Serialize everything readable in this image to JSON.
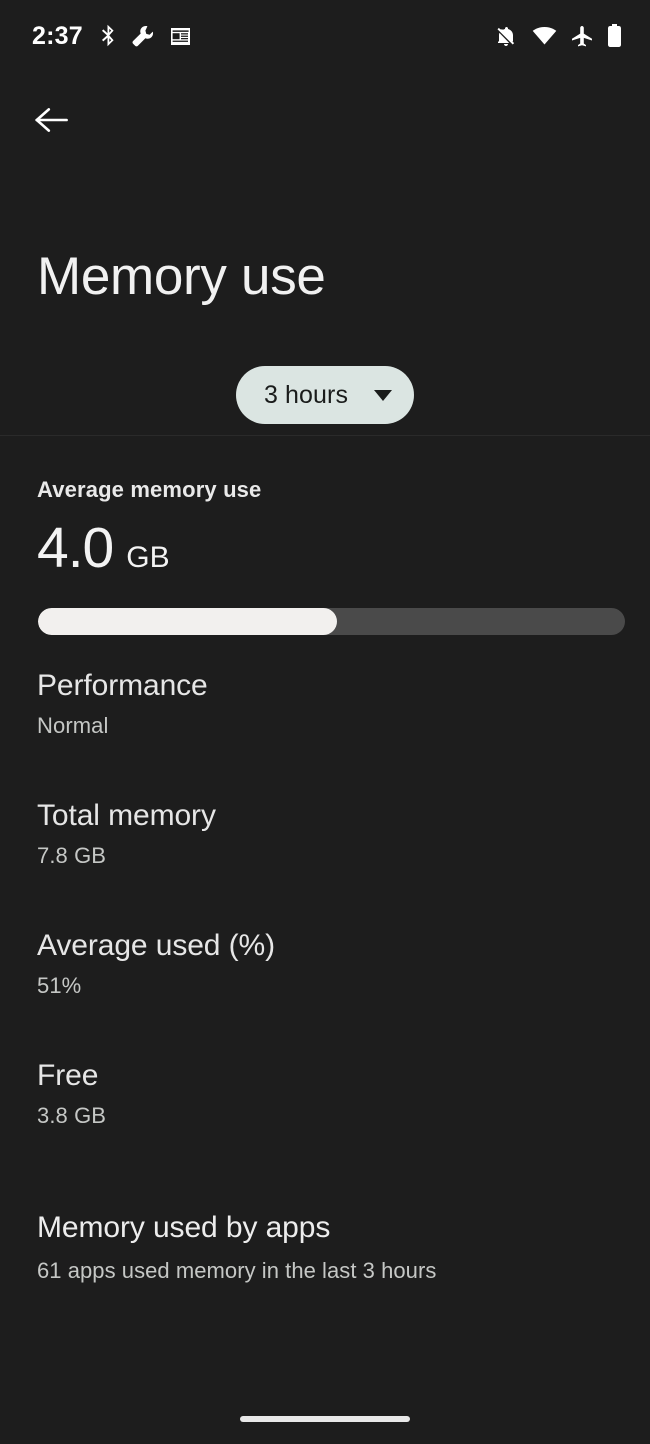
{
  "status_bar": {
    "time": "2:37",
    "left_icons": [
      "bluetooth-icon",
      "wrench-icon",
      "news-icon"
    ],
    "right_icons": [
      "notifications-off-icon",
      "wifi-icon",
      "airplane-mode-icon",
      "battery-icon"
    ]
  },
  "nav": {
    "back_icon": "back-arrow-icon"
  },
  "header": {
    "title": "Memory use",
    "time_range_chip": {
      "label": "3 hours",
      "caret_icon": "chevron-down-icon"
    }
  },
  "summary": {
    "label": "Average memory use",
    "value": "4.0",
    "unit": "GB",
    "usage_percent": 51
  },
  "stats": [
    {
      "title": "Performance",
      "value": "Normal"
    },
    {
      "title": "Total memory",
      "value": "7.8 GB"
    },
    {
      "title": "Average used (%)",
      "value": "51%"
    },
    {
      "title": "Free",
      "value": "3.8 GB"
    }
  ],
  "apps_section": {
    "title": "Memory used by apps",
    "subtitle": "61 apps used memory in the last 3 hours"
  },
  "colors": {
    "background": "#1d1d1d",
    "chip_background": "#dbe5e2",
    "bar_fill": "#f2f0ee",
    "bar_track": "#4a4a4a",
    "primary_text": "#f1f1f1",
    "secondary_text": "#c5c7c5"
  }
}
